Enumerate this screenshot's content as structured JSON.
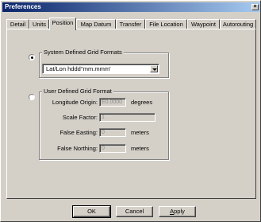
{
  "window": {
    "title": "Preferences",
    "close_glyph": "×"
  },
  "tabs": [
    {
      "label": "Detail"
    },
    {
      "label": "Units"
    },
    {
      "label": "Position"
    },
    {
      "label": "Map Datum"
    },
    {
      "label": "Transfer"
    },
    {
      "label": "File Location"
    },
    {
      "label": "Waypoint"
    },
    {
      "label": "Autorouting"
    }
  ],
  "active_tab": "Position",
  "system_group": {
    "title": "System Defined Grid Formats",
    "selected": true,
    "combo_value": "Lat/Lon hddd°mm.mmm'"
  },
  "user_group": {
    "title": "User Defined Grid Format",
    "selected": false,
    "fields": [
      {
        "label": "Longitude Origin:",
        "value": "E0.0000",
        "unit": "degrees"
      },
      {
        "label": "Scale Factor:",
        "value": "1",
        "unit": ""
      },
      {
        "label": "False Easting:",
        "value": "0",
        "unit": "meters"
      },
      {
        "label": "False Northing:",
        "value": "0",
        "unit": "meters"
      }
    ]
  },
  "buttons": {
    "ok": "OK",
    "cancel": "Cancel",
    "apply_accel": "A",
    "apply_rest": "pply"
  }
}
